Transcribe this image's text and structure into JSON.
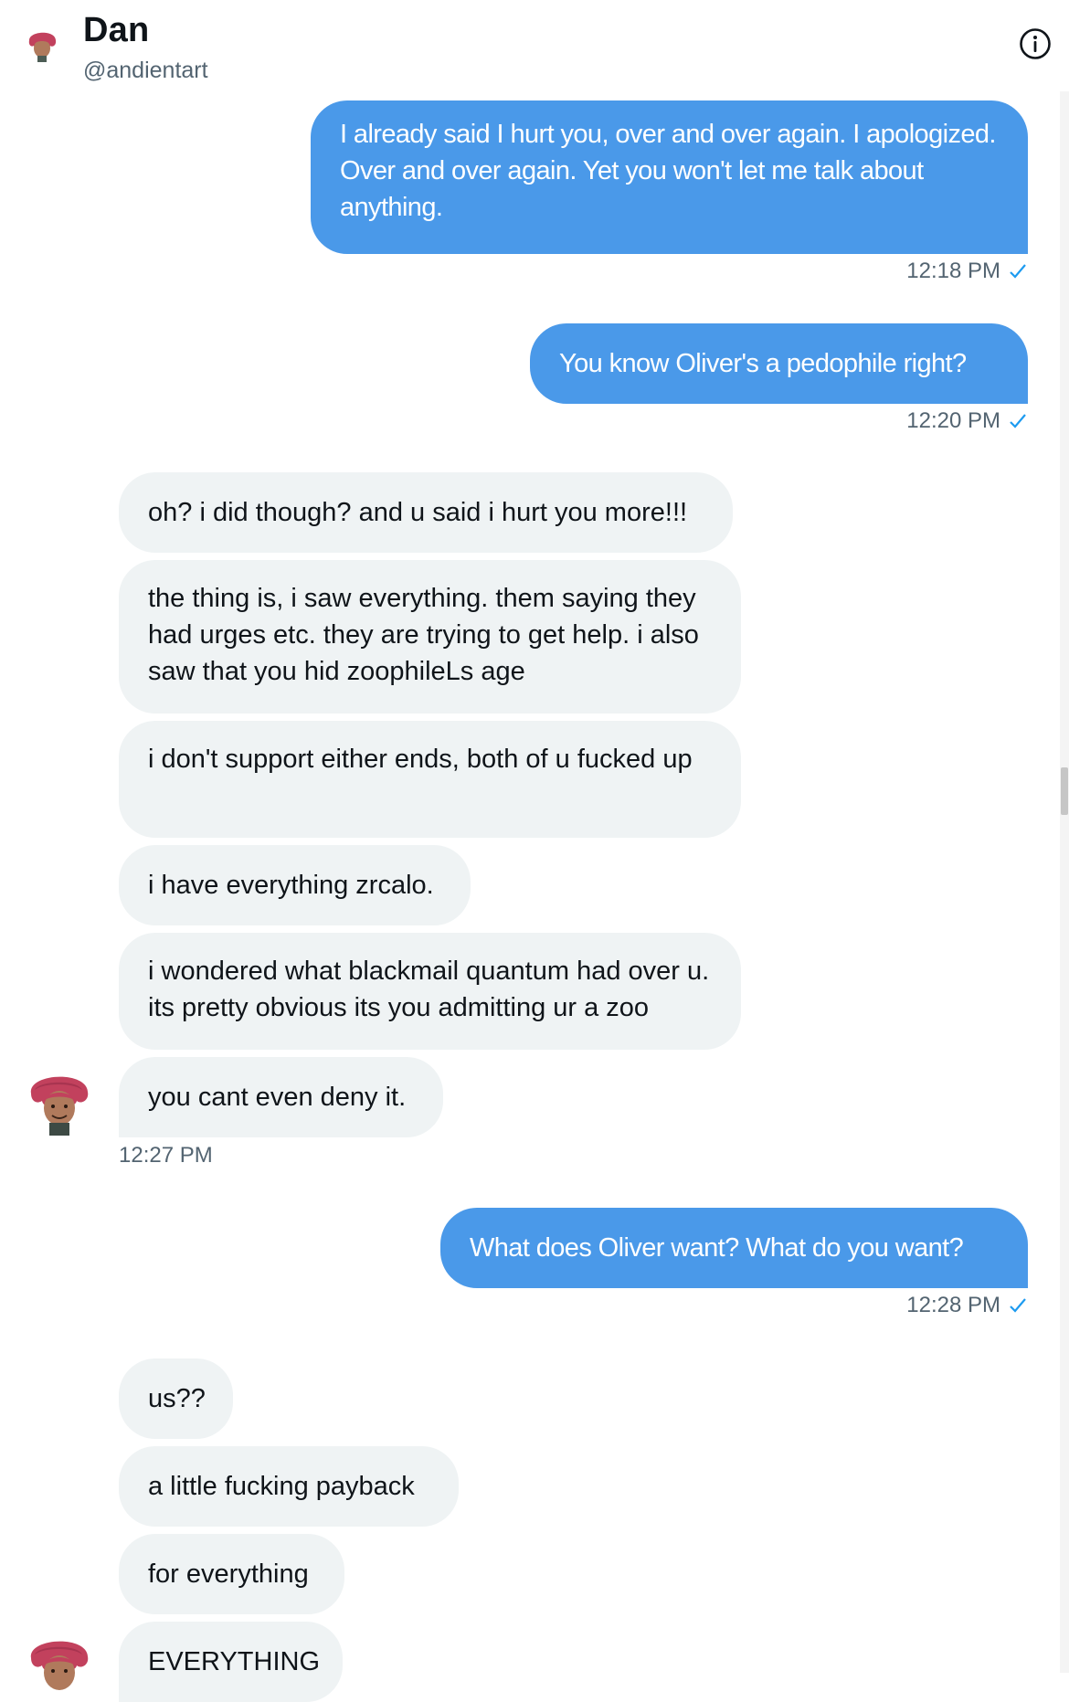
{
  "header": {
    "name": "Dan",
    "handle": "@andientart",
    "info_icon": "info-circle-icon",
    "avatar_icon": "user-avatar-icon"
  },
  "colors": {
    "sent_bubble": "#4a99e9",
    "received_bubble": "#eff3f4",
    "timestamp": "#536471",
    "read_check": "#1d9bf0"
  },
  "messages": [
    {
      "direction": "sent",
      "text": "I already said I hurt you, over and over again. I apologized. Over and over again. Yet you won't let me talk about anything.",
      "time": "12:18 PM",
      "read_icon": "checkmark-icon"
    },
    {
      "direction": "sent",
      "text": "You know Oliver's a pedophile right?",
      "time": "12:20 PM",
      "read_icon": "checkmark-icon"
    },
    {
      "direction": "received",
      "text": "oh? i did though? and u said i hurt you more!!!"
    },
    {
      "direction": "received",
      "text": "the thing is, i saw everything. them saying they had urges etc. they are trying to get help. i also saw that you hid zoophileLs age"
    },
    {
      "direction": "received",
      "text": "i don't support either ends, both of u fucked up"
    },
    {
      "direction": "received",
      "text": "i have everything zrcalo."
    },
    {
      "direction": "received",
      "text": "i wondered what blackmail quantum had over u. its pretty obvious its you admitting ur a zoo"
    },
    {
      "direction": "received",
      "text": "you cant even deny it.",
      "time": "12:27 PM"
    },
    {
      "direction": "sent",
      "text": "What does Oliver want? What do you want?",
      "time": "12:28 PM",
      "read_icon": "checkmark-icon"
    },
    {
      "direction": "received",
      "text": "us??"
    },
    {
      "direction": "received",
      "text": "a little fucking payback"
    },
    {
      "direction": "received",
      "text": "for everything"
    },
    {
      "direction": "received",
      "text": "EVERYTHING"
    }
  ]
}
